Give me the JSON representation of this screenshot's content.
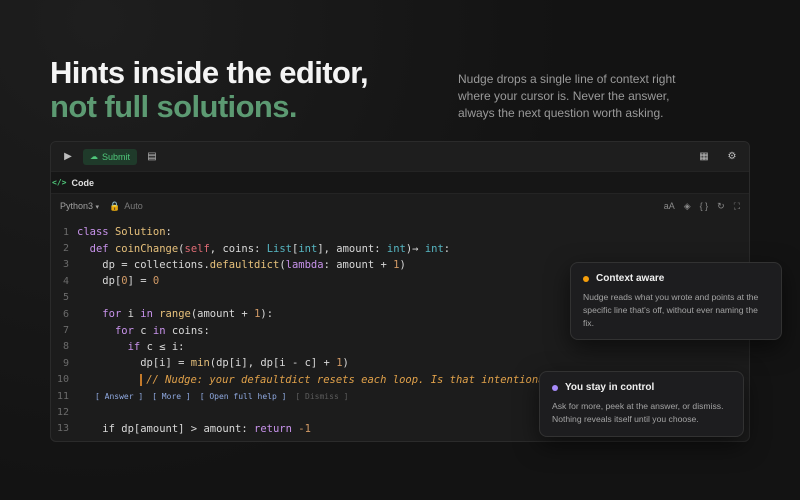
{
  "hero": {
    "headline_line1": "Hints inside the editor,",
    "headline_line2": "not full solutions.",
    "subtext": "Nudge drops a single line of context right where your cursor is. Never the answer, always the next question worth asking."
  },
  "editor": {
    "toolbar": {
      "run_icon": "play-icon",
      "submit_label": "Submit",
      "submit_icon": "cloud-upload-icon",
      "notes_icon": "notes-icon",
      "layout_icon": "layout-icon",
      "settings_icon": "gear-icon"
    },
    "tab": {
      "icon_text": "</>",
      "label": "Code"
    },
    "language": {
      "selected": "Python3",
      "chevron": "▾",
      "mode": "Auto",
      "lock_icon": "lock-icon"
    },
    "right_tools": [
      "aA",
      "◈",
      "{ }",
      "↻",
      "⛶"
    ],
    "lines": {
      "1": "1",
      "2": "2",
      "3": "3",
      "4": "4",
      "5": "5",
      "6": "6",
      "7": "7",
      "8": "8",
      "9": "9",
      "10": "10",
      "11": "11",
      "12": "12",
      "13": "13"
    },
    "nudge_comment": "// Nudge: your defaultdict resets each loop. Is that intentional?",
    "actions": [
      "[ Answer ]",
      "[ More ]",
      "[ Open full help ]",
      "[ Dismiss ]"
    ],
    "code_tokens": {
      "class": "class",
      "Solution": "Solution",
      "colon": ":",
      "def": "def",
      "coinChange": "coinChange",
      "self": "self",
      "coins": "coins",
      "List": "List",
      "int": "int",
      "amount": "amount",
      "arrow": "→",
      "dp_assign": "dp = collections.",
      "defaultdict": "defaultdict",
      "lambda": "lambda",
      "amount_plus": ": amount + ",
      "one": "1",
      "dp0": "dp[",
      "zero": "0",
      "eq": "] = ",
      "for": "for",
      "i": "i",
      "in": "in",
      "range": "range",
      "range_args": "(amount + ",
      "c": "c",
      "if": "if",
      "c_le_i": "c ≤ i:",
      "dpi_assign": "dp[i] = ",
      "min": "min",
      "min_args": "(dp[i], dp[i - c] + ",
      "if_amt": "if dp[amount] > amount: ",
      "return": "return",
      "neg1": "-1"
    }
  },
  "cards": [
    {
      "title": "Context aware",
      "dot_color": "#f59e0b",
      "body": "Nudge reads what you wrote and points at the specific line that's off, without ever naming the fix."
    },
    {
      "title": "You stay in control",
      "dot_color": "#a78bfa",
      "body": "Ask for more, peek at the answer, or dismiss. Nothing reveals itself until you choose."
    }
  ],
  "colors": {
    "accent_green": "#5c9a72",
    "submit_green": "#4fc77a",
    "nudge_orange": "#e0a14a",
    "background": "#131313"
  }
}
